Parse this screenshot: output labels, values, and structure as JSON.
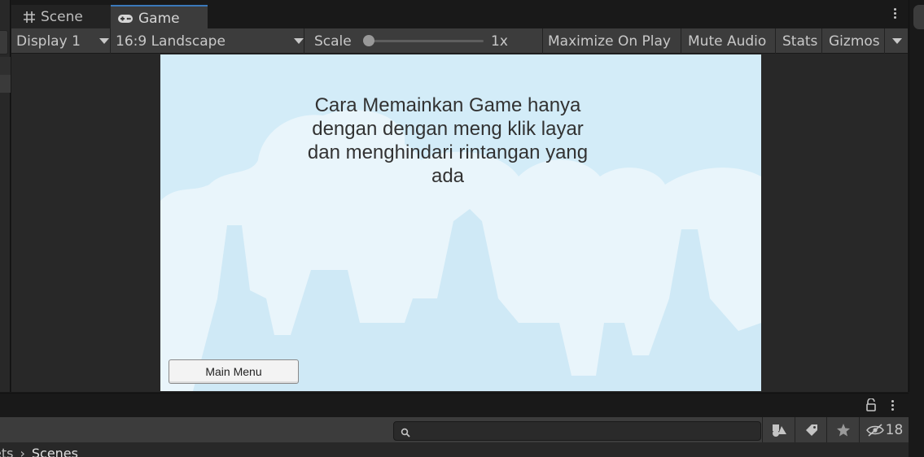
{
  "tabs": [
    {
      "label": "Scene",
      "icon": "grid-icon"
    },
    {
      "label": "Game",
      "icon": "gamepad-icon",
      "active": true
    }
  ],
  "toolbar": {
    "display": "Display 1",
    "aspect": "16:9 Landscape",
    "scale_label": "Scale",
    "scale_value": "1x",
    "maximize": "Maximize On Play",
    "mute": "Mute Audio",
    "stats": "Stats",
    "gizmos": "Gizmos"
  },
  "game": {
    "instructions": "Cara Memainkan Game hanya dengan dengan meng klik layar dan menghindari rintangan yang ada",
    "main_menu_button": "Main Menu"
  },
  "project": {
    "search_placeholder": "",
    "hidden_count": "18",
    "breadcrumb": [
      "ets",
      "Scenes"
    ]
  },
  "colors": {
    "editor_bg": "#282828",
    "toolbar_bg": "#3c3c3c",
    "tab_accent": "#3a79bb",
    "sky": "#d3ecf8"
  }
}
